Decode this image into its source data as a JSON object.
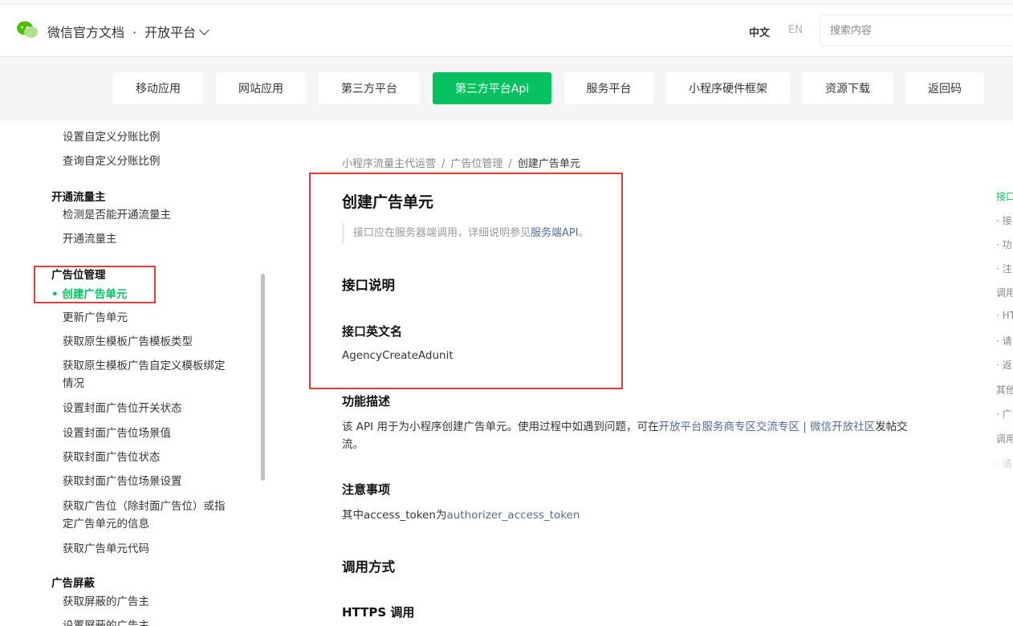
{
  "header": {
    "brand": "微信官方文档",
    "dot": "·",
    "platform": "开放平台",
    "lang_zh": "中文",
    "lang_en": "EN",
    "search_placeholder": "搜索内容"
  },
  "nav": {
    "items": [
      "移动应用",
      "网站应用",
      "第三方平台",
      "第三方平台Api",
      "服务平台",
      "小程序硬件框架",
      "资源下载",
      "返回码"
    ],
    "active_index": 3,
    "active_color": "#07c160"
  },
  "sidebar": {
    "items": [
      {
        "type": "item",
        "label": "设置自定义分账比例"
      },
      {
        "type": "item",
        "label": "查询自定义分账比例"
      },
      {
        "type": "head",
        "label": "开通流量主"
      },
      {
        "type": "item",
        "label": "检测是否能开通流量主"
      },
      {
        "type": "item",
        "label": "开通流量主"
      },
      {
        "type": "head",
        "label": "广告位管理"
      },
      {
        "type": "active",
        "label": "创建广告单元",
        "bullet": "•"
      },
      {
        "type": "item",
        "label": "更新广告单元"
      },
      {
        "type": "item",
        "label": "获取原生模板广告模板类型"
      },
      {
        "type": "item",
        "label": "获取原生模板广告自定义模板绑定",
        "label2": "情况"
      },
      {
        "type": "item",
        "label": "设置封面广告位开关状态"
      },
      {
        "type": "item",
        "label": "设置封面广告位场景值"
      },
      {
        "type": "item",
        "label": "获取封面广告位状态"
      },
      {
        "type": "item",
        "label": "获取封面广告位场景设置"
      },
      {
        "type": "item",
        "label": "获取广告位（除封面广告位）或指",
        "label2": "定广告单元的信息"
      },
      {
        "type": "item",
        "label": "获取广告单元代码"
      },
      {
        "type": "head",
        "label": "广告屏蔽"
      },
      {
        "type": "item",
        "label": "获取屏蔽的广告主"
      },
      {
        "type": "item",
        "label": "设置屏蔽的广告主"
      }
    ]
  },
  "breadcrumb": {
    "items": [
      "小程序流量主代运营",
      "广告位管理",
      "创建广告单元"
    ],
    "separator": "/"
  },
  "content": {
    "title": "创建广告单元",
    "note_prefix": "接口应在服务器端调用，详细说明参见",
    "note_link": "服务端API",
    "note_suffix": "。",
    "sec_interface": "接口说明",
    "sec_english_name": "接口英文名",
    "english_name": "AgencyCreateAdunit",
    "sec_function": "功能描述",
    "func_text1": "该 API 用于为小程序创建广告单元。使用过程中如遇到问题，可在",
    "func_link1": "开放平台服务商专区交流专区",
    "func_sep": " | ",
    "func_link2": "微信开放社区",
    "func_text2": "发帖交流。",
    "sec_notes": "注意事项",
    "notes_prefix": "其中access_token为",
    "notes_link": "authorizer_access_token",
    "sec_call": "调用方式",
    "sec_https": "HTTPS 调用"
  },
  "toc": {
    "items": [
      {
        "label": "接口",
        "level": "active"
      },
      {
        "label": "· 接",
        "level": "sub"
      },
      {
        "label": "· 功",
        "level": "sub"
      },
      {
        "label": "· 注",
        "level": "sub"
      },
      {
        "label": "调用",
        "level": "top"
      },
      {
        "label": "· HT",
        "level": "sub"
      },
      {
        "label": "· 请",
        "level": "sub"
      },
      {
        "label": "· 返",
        "level": "sub"
      },
      {
        "label": "其他",
        "level": "top"
      },
      {
        "label": "· 广",
        "level": "sub"
      },
      {
        "label": "调用",
        "level": "top"
      },
      {
        "label": "· 请",
        "level": "faded"
      }
    ]
  },
  "colors": {
    "accent": "#07c160",
    "link": "#576b95",
    "highlight_box": "#e03c3c"
  }
}
